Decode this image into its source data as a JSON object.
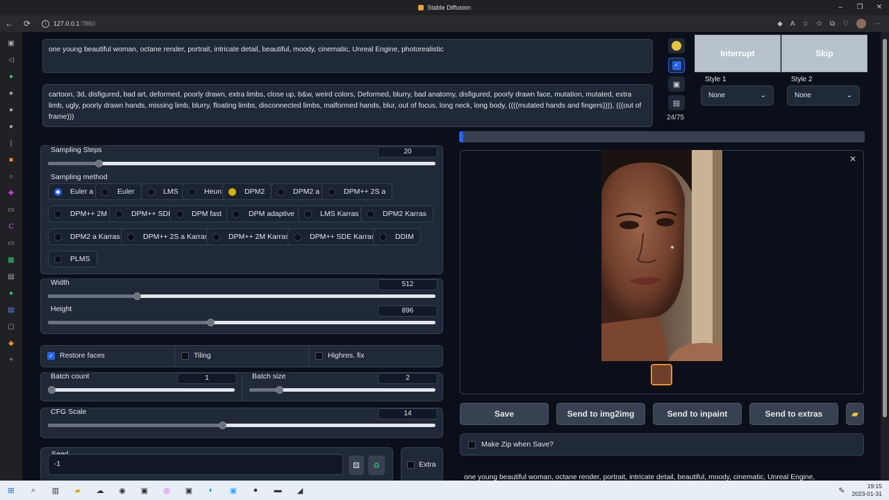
{
  "window": {
    "title": "Stable Diffusion",
    "controls": [
      "–",
      "❐",
      "✕"
    ]
  },
  "browser": {
    "url_host": "127.0.0.1",
    "url_port": ":7860",
    "back": "←",
    "refresh": "⟳"
  },
  "prompt": {
    "positive": "one young beautiful woman, octane render, portrait, intricate detail, beautiful, moody, cinematic, Unreal Engine, photorealistic",
    "negative": "cartoon, 3d, disfigured, bad art, deformed, poorly drawn, extra limbs, close up, b&w, weird colors, Deformed, blurry, bad anatomy, disfigured, poorly drawn face, mutation, mutated, extra limb, ugly, poorly drawn hands, missing limb, blurry, floating limbs, disconnected limbs, malformed hands, blur, out of focus, long neck, long body, ((((mutated hands and fingers)))), (((out of frame)))"
  },
  "token_counter": "24/75",
  "actions": {
    "interrupt": "Interrupt",
    "skip": "Skip"
  },
  "styles": {
    "style1_label": "Style 1",
    "style1_value": "None",
    "style2_label": "Style 2",
    "style2_value": "None"
  },
  "sampling_steps": {
    "label": "Sampling Steps",
    "value": "20",
    "fraction": 0.13
  },
  "sampling_method": {
    "label": "Sampling method",
    "selected": "Euler a",
    "options": [
      "Euler a",
      "Euler",
      "LMS",
      "Heun",
      "DPM2",
      "DPM2 a",
      "DPM++ 2S a",
      "DPM++ 2M",
      "DPM++ SDE",
      "DPM fast",
      "DPM adaptive",
      "LMS Karras",
      "DPM2 Karras",
      "DPM2 a Karras",
      "DPM++ 2S a Karras",
      "DPM++ 2M Karras",
      "DPM++ SDE Karras",
      "DDIM",
      "PLMS"
    ]
  },
  "width": {
    "label": "Width",
    "value": "512",
    "fraction": 0.23
  },
  "height": {
    "label": "Height",
    "value": "896",
    "fraction": 0.42
  },
  "checkboxes": {
    "restore_faces": "Restore faces",
    "restore_faces_checked": true,
    "tiling": "Tiling",
    "highres": "Highres. fix"
  },
  "batch_count": {
    "label": "Batch count",
    "value": "1",
    "fraction": 0.0
  },
  "batch_size": {
    "label": "Batch size",
    "value": "2",
    "fraction": 0.16
  },
  "cfg_scale": {
    "label": "CFG Scale",
    "value": "14",
    "fraction": 0.45
  },
  "seed": {
    "label": "Seed",
    "value": "-1",
    "extra": "Extra"
  },
  "progress": {
    "fraction": 0.01
  },
  "output_buttons": {
    "save": "Save",
    "img2img": "Send to img2img",
    "inpaint": "Send to inpaint",
    "extras": "Send to extras"
  },
  "make_zip": "Make Zip when Save?",
  "output_caption": "one young beautiful woman, octane render, portrait, intricate detail, beautiful, moody, cinematic, Unreal Engine,",
  "clock": {
    "time": "19:15",
    "date": "2023-01-31"
  },
  "colors": {
    "accent": "#2563eb",
    "background": "#0b0f19",
    "panel": "#1f2937",
    "action_button": "#b8c2cc"
  }
}
